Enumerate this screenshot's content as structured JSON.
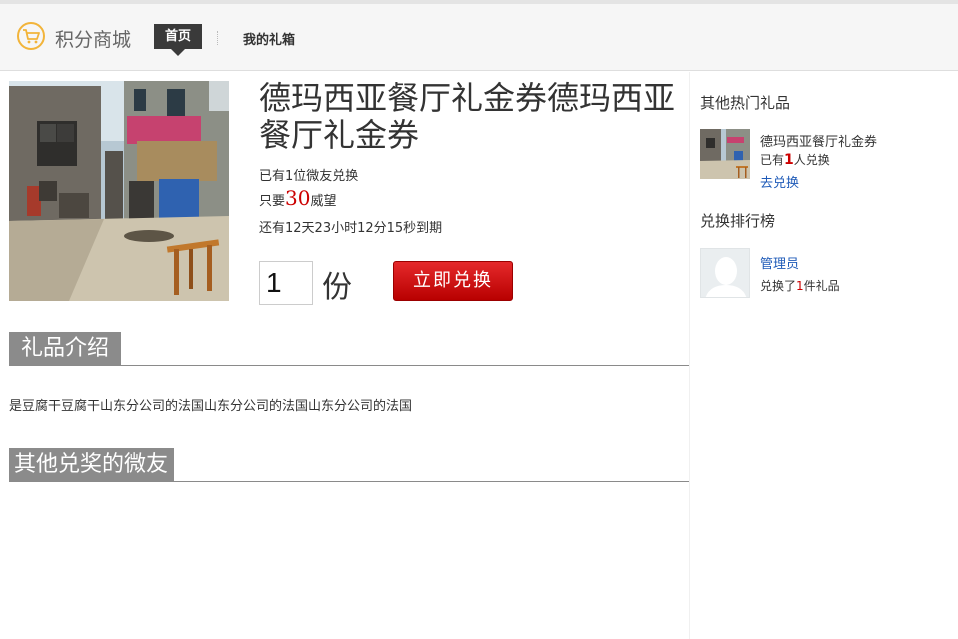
{
  "header": {
    "logo_text": "积分商城",
    "nav": {
      "home": "首页",
      "gift_box": "我的礼箱"
    }
  },
  "product": {
    "title": "德玛西亚餐厅礼金券德玛西亚餐厅礼金券",
    "redeemed_prefix": "已有1位微友兑换",
    "price_prefix": "只要",
    "price": "30",
    "price_unit": "威望",
    "countdown": "还有12天23小时12分15秒到期",
    "quantity": "1",
    "quantity_unit": "份",
    "redeem_button": "立即兑换"
  },
  "sections": {
    "intro_title": "礼品介绍",
    "intro_text": "是豆腐干豆腐干山东分公司的法国山东分公司的法国山东分公司的法国",
    "winners_title": "其他兑奖的微友"
  },
  "sidebar": {
    "hot_title": "其他热门礼品",
    "hot_items": [
      {
        "name": "德玛西亚餐厅礼金券",
        "count_prefix": "已有",
        "count": "1",
        "count_suffix": "人兑换",
        "link": "去兑换"
      }
    ],
    "rank_title": "兑换排行榜",
    "rank": [
      {
        "user": "管理员",
        "prefix": "兑换了",
        "count": "1",
        "suffix": "件礼品"
      }
    ]
  },
  "colors": {
    "accent_red": "#cc0000",
    "link_blue": "#1f5bb8",
    "section_gray": "#8b8b8b",
    "logo_orange": "#f2b43a"
  }
}
